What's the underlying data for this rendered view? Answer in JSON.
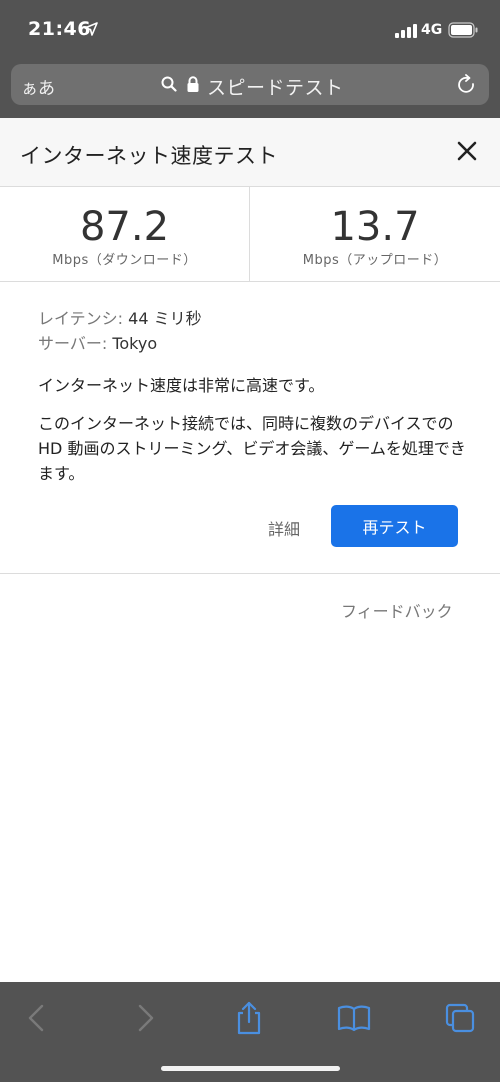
{
  "status": {
    "time": "21:46",
    "network": "4G"
  },
  "browser": {
    "aa_label": "ぁあ",
    "url_text": "スピードテスト"
  },
  "card": {
    "title": "インターネット速度テスト"
  },
  "download": {
    "value": "87.2",
    "unit": "Mbps（ダウンロード）"
  },
  "upload": {
    "value": "13.7",
    "unit": "Mbps（アップロード）"
  },
  "info": {
    "latency_label": "レイテンシ:",
    "latency_value": "44 ミリ秒",
    "server_label": "サーバー:",
    "server_value": "Tokyo"
  },
  "summary": "インターネット速度は非常に高速です。",
  "description": "このインターネット接続では、同時に複数のデバイスでの HD 動画のストリーミング、ビデオ会議、ゲームを処理できます。",
  "actions": {
    "details_label": "詳細",
    "retest_label": "再テスト"
  },
  "feedback_label": "フィードバック",
  "toolbar": {
    "items": [
      "back-icon",
      "forward-icon",
      "share-icon",
      "bookmarks-icon",
      "tabs-icon"
    ]
  },
  "colors": {
    "chrome": "#535353",
    "accent": "#1a73e8",
    "toolbar_active": "#4a8fe0"
  }
}
